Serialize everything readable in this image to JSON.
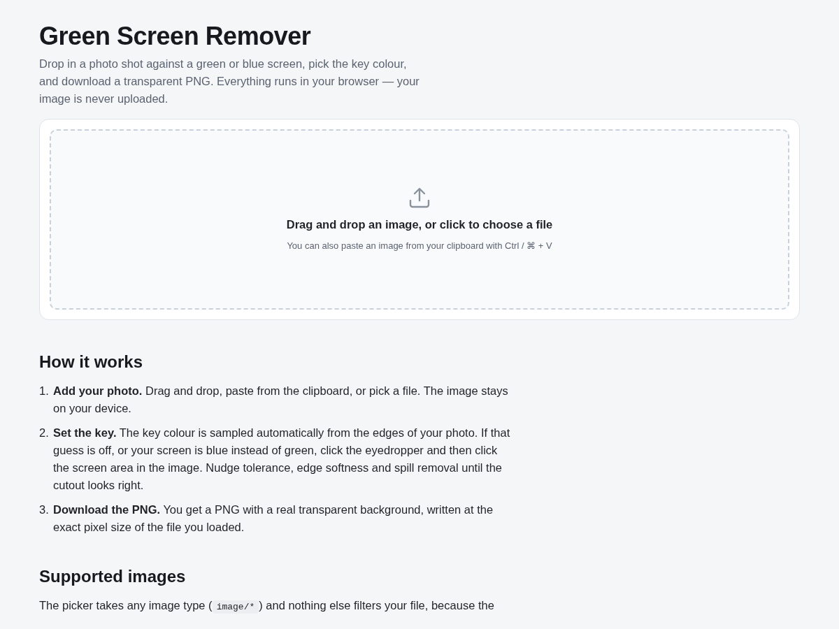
{
  "title": "Green Screen Remover",
  "intro": "Drop in a photo shot against a green or blue screen, pick the key colour, and download a transparent PNG. Everything runs in your browser — your image is never uploaded.",
  "dropzone": {
    "heading": "Drag and drop an image, or click to choose a file",
    "hint": "You can also paste an image from your clipboard with Ctrl / ⌘ + V"
  },
  "how_it_works": {
    "heading": "How it works",
    "steps": [
      {
        "number": "1.",
        "text": "**Add your photo.** Drag and drop, paste from the clipboard, or pick a file. The image stays on your device."
      },
      {
        "number": "2.",
        "text": "**Set the key.** The key colour is sampled automatically from the edges of your photo. If that guess is off, or your screen is blue instead of green, click the eyedropper and then click the screen area in the image. Nudge tolerance, edge softness and spill removal until the cutout looks right."
      },
      {
        "number": "3.",
        "text": "**Download the PNG.** You get a PNG with a real transparent background, written at the exact pixel size of the file you loaded."
      }
    ]
  },
  "supported_images": {
    "heading": "Supported images",
    "paragraph": [
      {
        "kind": "text",
        "text": "The picker takes any image type ("
      },
      {
        "kind": "code",
        "text": "image/*"
      },
      {
        "kind": "text",
        "text": ") and nothing else filters your file, because the"
      }
    ]
  }
}
